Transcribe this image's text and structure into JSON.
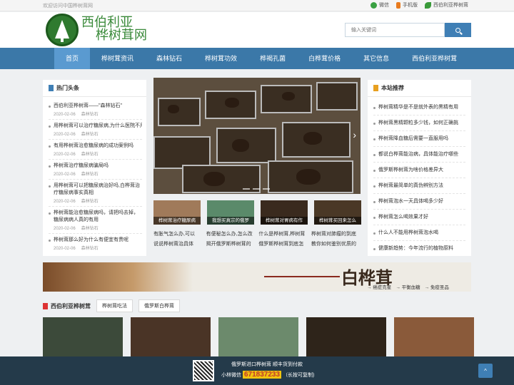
{
  "topbar": {
    "welcome": "欢迎访问中国桦树茸网",
    "wechat": "微信",
    "mobile": "手机版",
    "site_name": "西伯利亚桦树茸"
  },
  "logo": {
    "line1": "西伯利亚",
    "line2": "桦树茸网"
  },
  "search": {
    "placeholder": "输入关键词"
  },
  "nav": [
    "首页",
    "桦树茸资讯",
    "森林钻石",
    "桦树茸功效",
    "桦褐孔菌",
    "白桦茸价格",
    "其它信息",
    "西伯利亚桦树茸"
  ],
  "hot": {
    "title": "热门头条",
    "items": [
      {
        "title": "西伯利亚桦树茸——\"森林钻石\"",
        "date": "2020-02-06",
        "tag": "森林钻石"
      },
      {
        "title": "用桦树茸可以治疗糖尿病,为什么医院不用",
        "date": "2020-02-06",
        "tag": "森林钻石"
      },
      {
        "title": "有用桦树茸治愈糖尿病的成功案例吗",
        "date": "2020-02-06",
        "tag": "森林钻石"
      },
      {
        "title": "桦树茸治疗糖尿病骗局吗",
        "date": "2020-02-06",
        "tag": "森林钻石"
      },
      {
        "title": "用桦树茸可以把糖尿病治好吗,白桦茸治疗糖尿病事实真相",
        "title2": "糖尿病事实数子猪辩",
        "date": "2020-02-06",
        "tag": "森林钻石"
      },
      {
        "title": "桦树茸能治愈糖尿病吗，请把吗去掉，糖尿病病人真的有用",
        "title2": "尿病病人真的有用",
        "date": "2020-02-06",
        "tag": "森林钻石"
      },
      {
        "title": "桦树茸那么好为什么有便宜有贵呢",
        "date": "2020-02-06",
        "tag": "森林钻石"
      }
    ]
  },
  "rec": {
    "title": "本站推荐",
    "items": [
      "桦树茸精华是不是就外表的黑精有用",
      "桦树茸黑精颗粒多少钱，如何正确挑",
      "桦树茸降血糖后需要一直服用吗",
      "都说白桦茸能治病，具体能治疗哪些",
      "俄罗斯桦树茸为啥价格差异大",
      "桦树茸最简单的真伪辨别方法",
      "桦树茸泡水一天具体喝多少好",
      "桦树茸怎么喝效果才好",
      "什么人不能用桦树茸泡水喝",
      "健康新趋势：今年流行的植物原料"
    ]
  },
  "thumbs": [
    "桦树茸治疗糖尿病",
    "我想买真宗的俄罗",
    "桦树茸对胃病有作",
    "桦树茸买回来怎么"
  ],
  "news": [
    [
      "有胀气怎么办,可以",
      "有便秘怎么办,怎么改",
      "什么是桦树茸,桦树茸",
      "桦树茸对肺瘤的到底"
    ],
    [
      "说说桦树茸治具体",
      "揭开俄罗斯桦树茸的",
      "俄罗斯桦树茸到底怎",
      "教你如何鉴别优质的"
    ]
  ],
  "banner": {
    "title": "白桦茸",
    "tags": [
      "→ 癌症克星",
      "→ 平衡血糖",
      "→ 免疫圣品"
    ]
  },
  "section2": {
    "title": "西伯利亚桦树茸",
    "tabs": [
      "桦树茸吃法",
      "俄罗斯白桦茸"
    ]
  },
  "footer": {
    "line1": "俄罗斯进口桦树茸 顺丰货到付款",
    "prefix": "小林微信",
    "wechat_id": "671837233",
    "suffix": "（长按可复制)",
    "totop": "^"
  },
  "colors": {
    "nav": "#3b78a8",
    "nav_active": "#5a9ad0",
    "footer": "#243a4a",
    "logo_green": "#3a8a3a"
  }
}
